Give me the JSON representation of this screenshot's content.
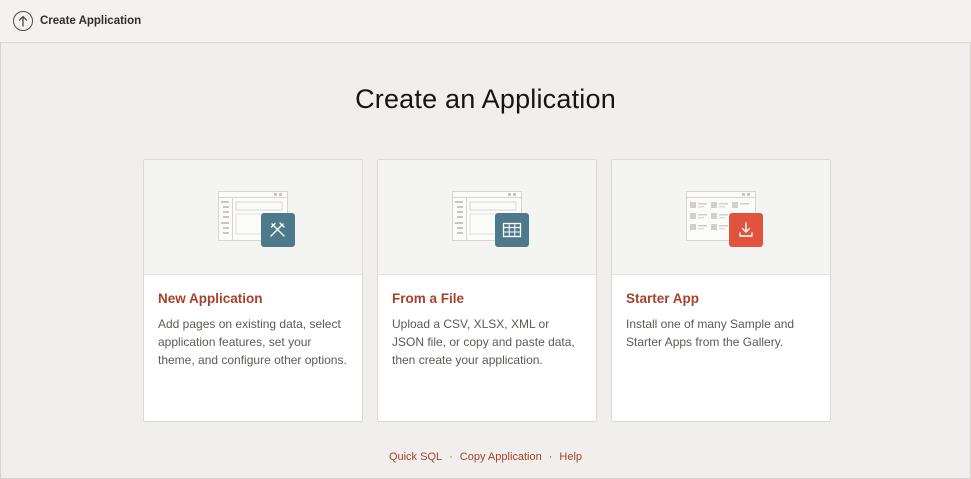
{
  "header": {
    "title": "Create Application",
    "back_icon": "arrow-up-circle-icon"
  },
  "main": {
    "title": "Create an Application",
    "cards": [
      {
        "title": "New Application",
        "description": "Add pages on existing data, select application features, set your theme, and configure other options.",
        "icon": "tools-icon",
        "badge_color": "#4c7a8a"
      },
      {
        "title": "From a File",
        "description": "Upload a CSV, XLSX, XML or JSON file, or copy and paste data, then create your application.",
        "icon": "table-grid-icon",
        "badge_color": "#4c7a8a"
      },
      {
        "title": "Starter App",
        "description": "Install one of many Sample and Starter Apps from the Gallery.",
        "icon": "download-icon",
        "badge_color": "#e0533f"
      }
    ]
  },
  "footer": {
    "links": [
      "Quick SQL",
      "Copy Application",
      "Help"
    ],
    "separator": "·"
  },
  "colors": {
    "accent": "#a7422a",
    "background": "#f1efed"
  }
}
